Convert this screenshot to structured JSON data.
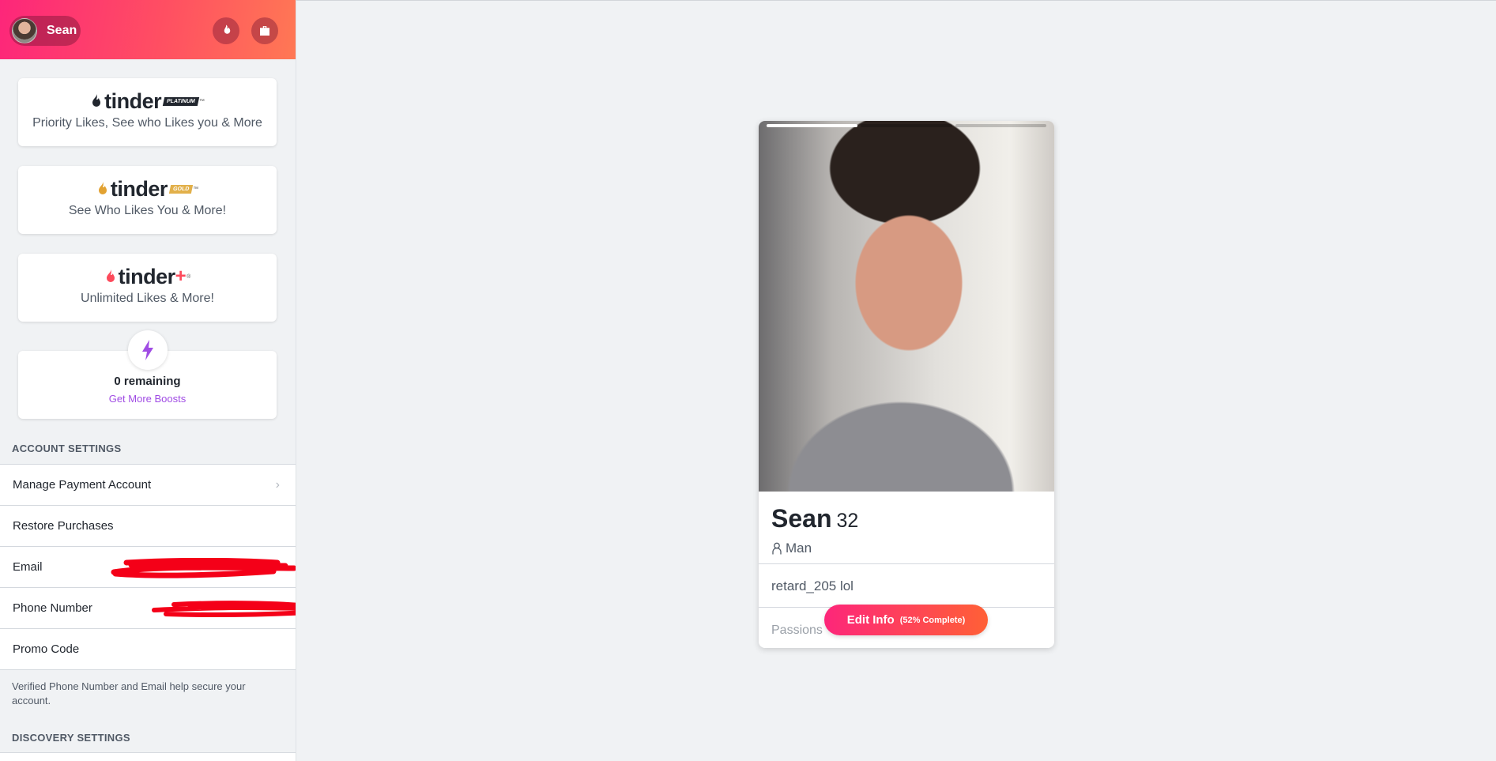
{
  "user": {
    "name": "Sean"
  },
  "promos": [
    {
      "brand": "tinder",
      "tier": "PLATINUM",
      "description": "Priority Likes, See who Likes you & More",
      "color": "#21262e"
    },
    {
      "brand": "tinder",
      "tier": "GOLD",
      "description": "See Who Likes You & More!",
      "color": "#d49b2a"
    },
    {
      "brand": "tinder",
      "tier": "+",
      "description": "Unlimited Likes & More!",
      "color": "#fd4a5b"
    }
  ],
  "boost": {
    "remaining": "0 remaining",
    "link": "Get More Boosts"
  },
  "account_settings": {
    "title": "ACCOUNT SETTINGS",
    "items": [
      {
        "label": "Manage Payment Account"
      },
      {
        "label": "Restore Purchases"
      },
      {
        "label": "Email"
      },
      {
        "label": "Phone Number"
      },
      {
        "label": "Promo Code"
      }
    ],
    "note": "Verified Phone Number and Email help secure your account."
  },
  "discovery_settings": {
    "title": "DISCOVERY SETTINGS"
  },
  "profile": {
    "name": "Sean",
    "age": "32",
    "gender": "Man",
    "bio": "retard_205 lol",
    "passions_label": "Passions",
    "photo_count": 3,
    "active_photo": 1
  },
  "edit_button": {
    "label": "Edit Info",
    "progress": "(52% Complete)"
  },
  "colors": {
    "brand_pink": "#fd267a",
    "brand_orange": "#ff7854",
    "boost_purple": "#a04ce4"
  }
}
